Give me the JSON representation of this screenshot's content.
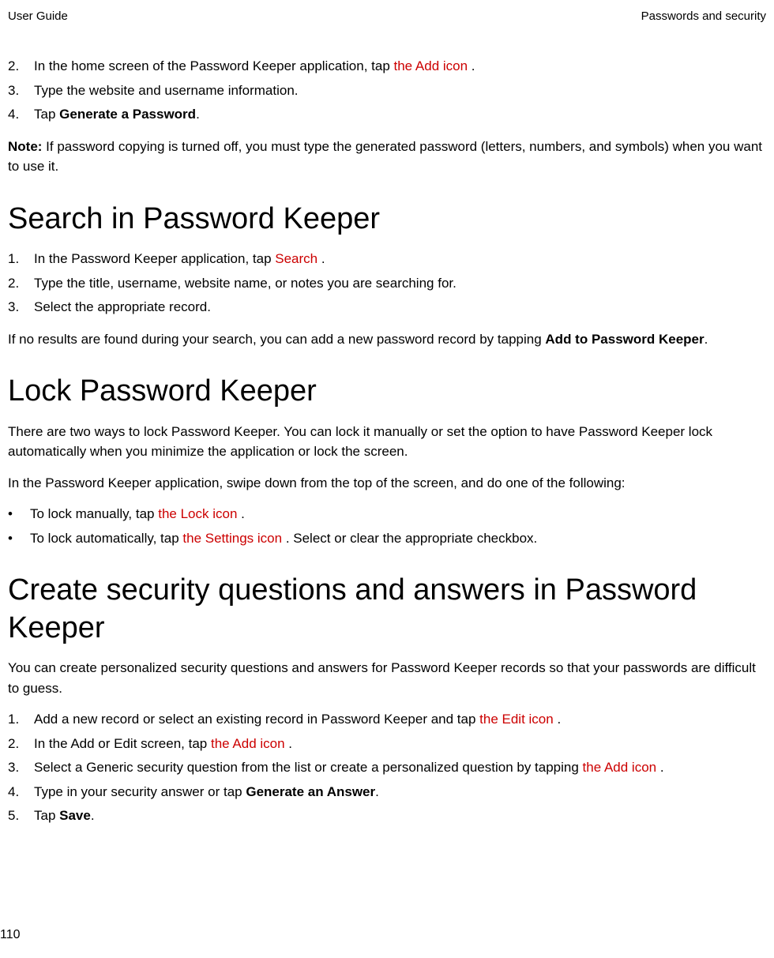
{
  "header": {
    "left": "User Guide",
    "right": "Passwords and security"
  },
  "intro_list": [
    {
      "num": "2.",
      "pre": "In the home screen of the Password Keeper application, tap  ",
      "red": "the Add icon",
      "post": " ."
    },
    {
      "num": "3.",
      "pre": "Type the website and username information.",
      "red": "",
      "post": ""
    },
    {
      "num": "4.",
      "pre": "Tap ",
      "bold": "Generate a Password",
      "post2": "."
    }
  ],
  "note": {
    "label": "Note: ",
    "text": "If password copying is turned off, you must type the generated password (letters, numbers, and symbols) when you want to use it."
  },
  "search": {
    "heading": "Search in Password Keeper",
    "list": [
      {
        "num": "1.",
        "pre": "In the Password Keeper application, tap  ",
        "red": "Search",
        "post": " ."
      },
      {
        "num": "2.",
        "pre": "Type the title, username, website name, or notes you are searching for.",
        "red": "",
        "post": ""
      },
      {
        "num": "3.",
        "pre": "Select the appropriate record.",
        "red": "",
        "post": ""
      }
    ],
    "followup_pre": "If no results are found during your search, you can add a new password record by tapping ",
    "followup_bold": "Add to Password Keeper",
    "followup_post": "."
  },
  "lock": {
    "heading": "Lock Password Keeper",
    "desc": "There are two ways to lock Password Keeper. You can lock it manually or set the option to have Password Keeper lock automatically when you minimize the application or lock the screen.",
    "intro": "In the Password Keeper application, swipe down from the top of the screen, and do one of the following:",
    "bullets": [
      {
        "pre": "To lock manually, tap  ",
        "red": "the Lock icon",
        "post": " ."
      },
      {
        "pre": "To lock automatically, tap  ",
        "red": "the Settings icon",
        "post": " . Select or clear the appropriate checkbox."
      }
    ]
  },
  "security": {
    "heading": "Create security questions and answers in Password Keeper",
    "desc": "You can create personalized security questions and answers for Password Keeper records so that your passwords are difficult to guess.",
    "list": [
      {
        "num": "1.",
        "pre": "Add a new record or select an existing record in Password Keeper and tap  ",
        "red": "the Edit icon",
        "post": " ."
      },
      {
        "num": "2.",
        "pre": "In the Add or Edit screen, tap  ",
        "red": "the Add icon",
        "post": " ."
      },
      {
        "num": "3.",
        "pre": "Select a Generic security question from the list or create a personalized question by tapping  ",
        "red": "the Add icon",
        "post": " ."
      },
      {
        "num": "4.",
        "pre": "Type in your security answer or tap ",
        "bold": "Generate an Answer",
        "post2": "."
      },
      {
        "num": "5.",
        "pre": "Tap ",
        "bold": "Save",
        "post2": "."
      }
    ]
  },
  "page_number": "110"
}
